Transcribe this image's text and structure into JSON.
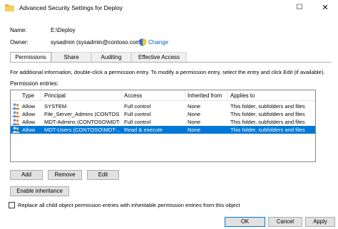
{
  "window": {
    "title": "Advanced Security Settings for Deploy",
    "maximize_glyph": "☐",
    "close_glyph": "✕"
  },
  "details": {
    "name_label": "Name:",
    "name_value": "E:\\Deploy",
    "owner_label": "Owner:",
    "owner_value": "sysadmin (sysadmin@contoso.com)",
    "change_link": "Change"
  },
  "tabs": [
    {
      "label": "Permissions",
      "active": true
    },
    {
      "label": "Share",
      "active": false
    },
    {
      "label": "Auditing",
      "active": false
    },
    {
      "label": "Effective Access",
      "active": false
    }
  ],
  "info_text": "For additional information, double-click a permission entry. To modify a permission entry, select the entry and click Edit (if available).",
  "entries_label": "Permission entries:",
  "table": {
    "headers": [
      "Type",
      "Principal",
      "Access",
      "Inherited from",
      "Applies to"
    ],
    "rows": [
      {
        "type": "Allow",
        "principal": "SYSTEM",
        "access": "Full control",
        "inherited": "None",
        "applies": "This folder, subfolders and files",
        "selected": false
      },
      {
        "type": "Allow",
        "principal": "File_Server_Admins (CONTOS...",
        "access": "Full control",
        "inherited": "None",
        "applies": "This folder, subfolders and files",
        "selected": false
      },
      {
        "type": "Allow",
        "principal": "MDT-Admins (CONTOSO\\MDT-...",
        "access": "Full control",
        "inherited": "None",
        "applies": "This folder, subfolders and files",
        "selected": false
      },
      {
        "type": "Allow",
        "principal": "MDT-Users (CONTOSO\\MDT-...",
        "access": "Read & execute",
        "inherited": "None",
        "applies": "This folder, subfolders and files",
        "selected": true
      }
    ]
  },
  "buttons": {
    "add": "Add",
    "remove": "Remove",
    "edit": "Edit",
    "enable_inheritance": "Enable inheritance",
    "ok": "OK",
    "cancel": "Cancel",
    "apply": "Apply"
  },
  "replace_checkbox": {
    "label": "Replace all child object permission entries with inheritable permission entries from this object",
    "checked": false
  },
  "colors": {
    "selection": "#0078d7",
    "link": "#0066cc"
  }
}
